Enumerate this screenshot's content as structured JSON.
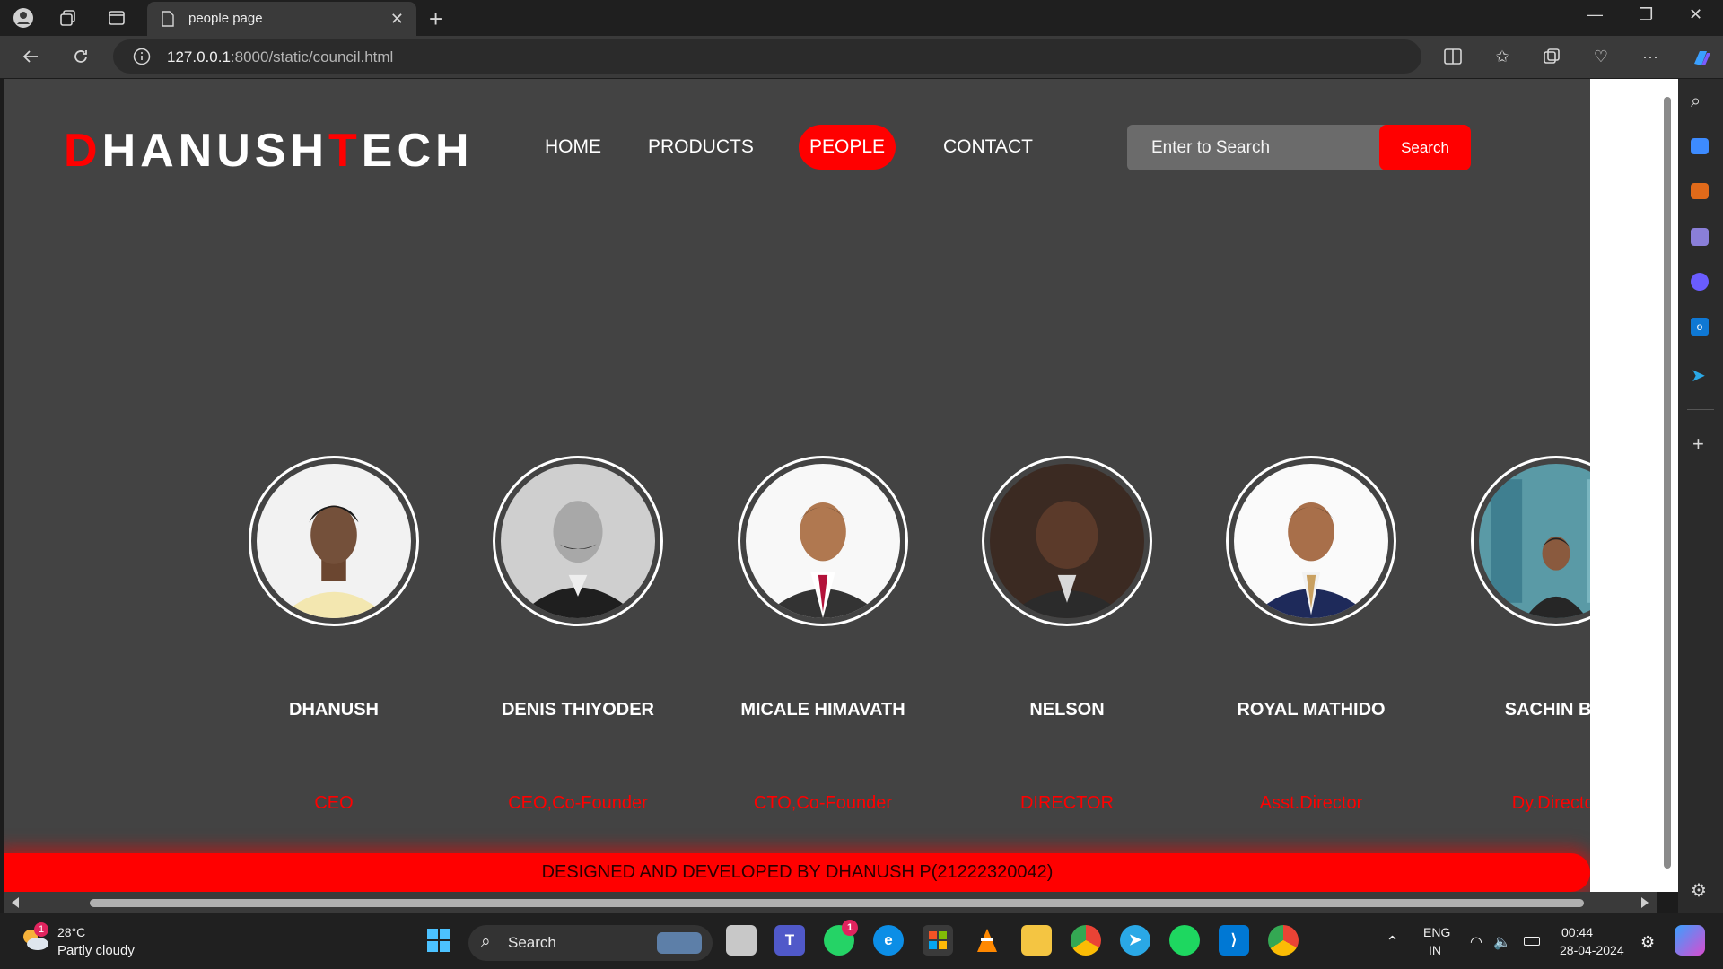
{
  "browser": {
    "tab_title": "people page",
    "url_host": "127.0.0.1",
    "url_rest": ":8000/static/council.html"
  },
  "site": {
    "logo_first_letter": "D",
    "logo_part1": "HANUSH",
    "logo_second_letter": "T",
    "logo_part2": "ECH",
    "nav": [
      {
        "label": "HOME",
        "active": false
      },
      {
        "label": "PRODUCTS",
        "active": false
      },
      {
        "label": "PEOPLE",
        "active": true
      },
      {
        "label": "CONTACT",
        "active": false
      }
    ],
    "search_placeholder": "Enter to Search",
    "search_button": "Search",
    "accent_color": "#ff0000",
    "background_color": "#434343",
    "people": [
      {
        "name": "DHANUSH",
        "role": "CEO"
      },
      {
        "name": "DENIS THIYODER",
        "role": "CEO,Co-Founder"
      },
      {
        "name": "MICALE HIMAVATH",
        "role": "CTO,Co-Founder"
      },
      {
        "name": "NELSON",
        "role": "DIRECTOR"
      },
      {
        "name": "ROYAL MATHIDO",
        "role": "Asst.Director"
      },
      {
        "name": "SACHIN BIL",
        "role": "Dy.Director"
      }
    ],
    "footer": "DESIGNED AND DEVELOPED BY DHANUSH P(21222320042)"
  },
  "taskbar": {
    "weather_temp": "28°C",
    "weather_desc": "Partly cloudy",
    "weather_badge": "1",
    "search_label": "Search",
    "whatsapp_badge": "1",
    "lang_line1": "ENG",
    "lang_line2": "IN",
    "time": "00:44",
    "date": "28-04-2024"
  }
}
